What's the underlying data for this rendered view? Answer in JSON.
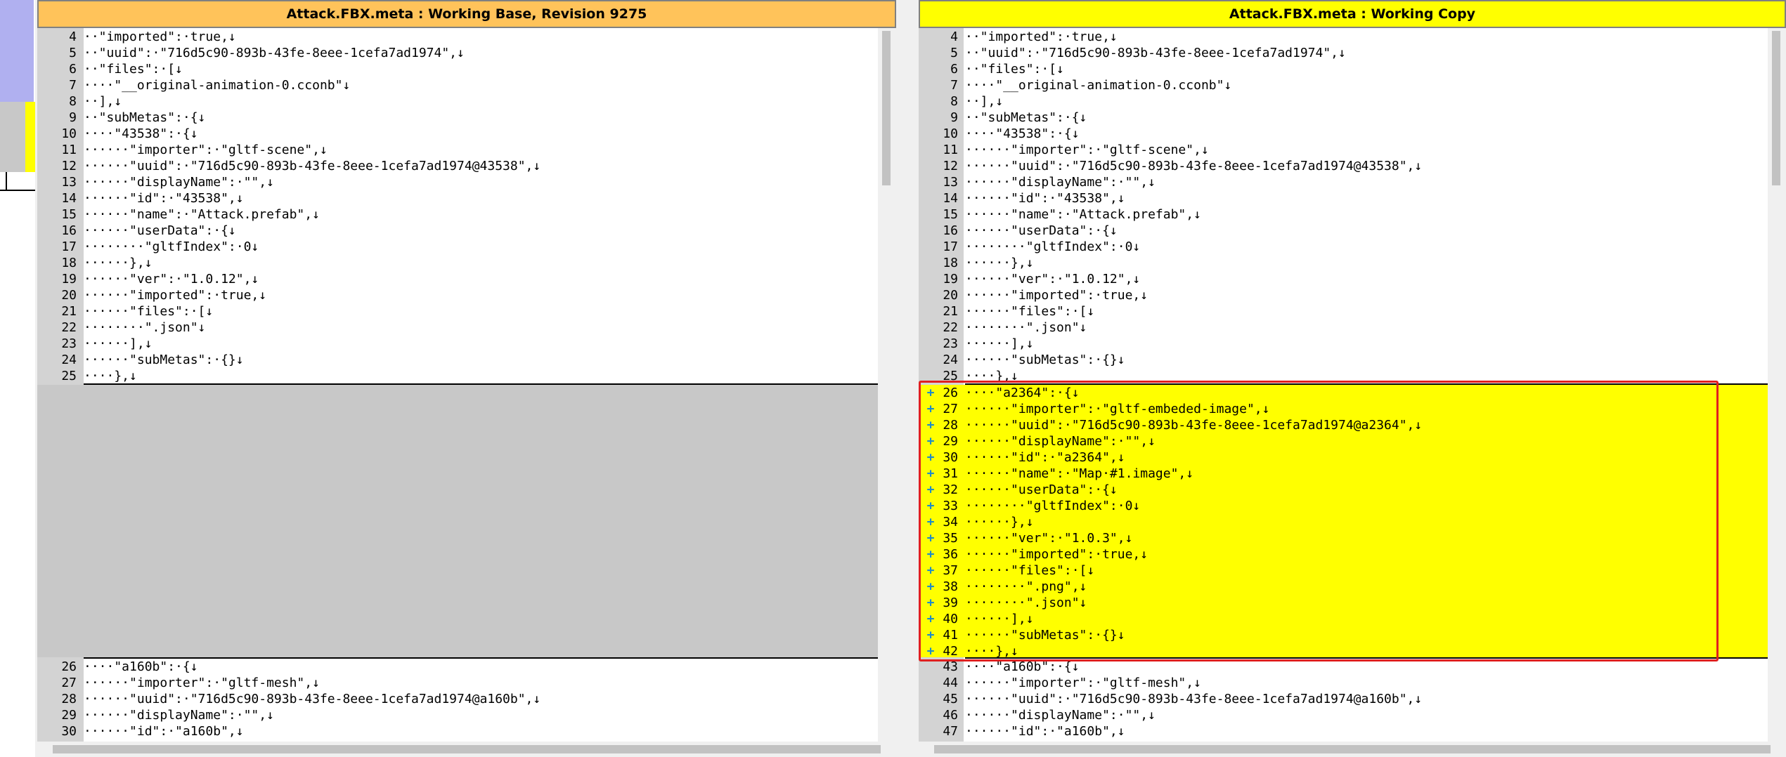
{
  "left": {
    "title": "Attack.FBX.meta : Working Base, Revision 9275",
    "top_lines": [
      {
        "n": "4",
        "t": "··\"imported\":·true,↓"
      },
      {
        "n": "5",
        "t": "··\"uuid\":·\"716d5c90-893b-43fe-8eee-1cefa7ad1974\",↓"
      },
      {
        "n": "6",
        "t": "··\"files\":·[↓"
      },
      {
        "n": "7",
        "t": "····\"__original-animation-0.cconb\"↓"
      },
      {
        "n": "8",
        "t": "··],↓"
      },
      {
        "n": "9",
        "t": "··\"subMetas\":·{↓"
      },
      {
        "n": "10",
        "t": "····\"43538\":·{↓"
      },
      {
        "n": "11",
        "t": "······\"importer\":·\"gltf-scene\",↓"
      },
      {
        "n": "12",
        "t": "······\"uuid\":·\"716d5c90-893b-43fe-8eee-1cefa7ad1974@43538\",↓"
      },
      {
        "n": "13",
        "t": "······\"displayName\":·\"\",↓"
      },
      {
        "n": "14",
        "t": "······\"id\":·\"43538\",↓"
      },
      {
        "n": "15",
        "t": "······\"name\":·\"Attack.prefab\",↓"
      },
      {
        "n": "16",
        "t": "······\"userData\":·{↓"
      },
      {
        "n": "17",
        "t": "········\"gltfIndex\":·0↓"
      },
      {
        "n": "18",
        "t": "······},↓"
      },
      {
        "n": "19",
        "t": "······\"ver\":·\"1.0.12\",↓"
      },
      {
        "n": "20",
        "t": "······\"imported\":·true,↓"
      },
      {
        "n": "21",
        "t": "······\"files\":·[↓"
      },
      {
        "n": "22",
        "t": "········\".json\"↓"
      },
      {
        "n": "23",
        "t": "······],↓"
      },
      {
        "n": "24",
        "t": "······\"subMetas\":·{}↓"
      },
      {
        "n": "25",
        "t": "····},↓"
      }
    ],
    "bottom_lines": [
      {
        "n": "26",
        "t": "····\"a160b\":·{↓"
      },
      {
        "n": "27",
        "t": "······\"importer\":·\"gltf-mesh\",↓"
      },
      {
        "n": "28",
        "t": "······\"uuid\":·\"716d5c90-893b-43fe-8eee-1cefa7ad1974@a160b\",↓"
      },
      {
        "n": "29",
        "t": "······\"displayName\":·\"\",↓"
      },
      {
        "n": "30",
        "t": "······\"id\":·\"a160b\",↓"
      }
    ]
  },
  "right": {
    "title": "Attack.FBX.meta : Working Copy",
    "top_lines": [
      {
        "n": "4",
        "t": "··\"imported\":·true,↓"
      },
      {
        "n": "5",
        "t": "··\"uuid\":·\"716d5c90-893b-43fe-8eee-1cefa7ad1974\",↓"
      },
      {
        "n": "6",
        "t": "··\"files\":·[↓"
      },
      {
        "n": "7",
        "t": "····\"__original-animation-0.cconb\"↓"
      },
      {
        "n": "8",
        "t": "··],↓"
      },
      {
        "n": "9",
        "t": "··\"subMetas\":·{↓"
      },
      {
        "n": "10",
        "t": "····\"43538\":·{↓"
      },
      {
        "n": "11",
        "t": "······\"importer\":·\"gltf-scene\",↓"
      },
      {
        "n": "12",
        "t": "······\"uuid\":·\"716d5c90-893b-43fe-8eee-1cefa7ad1974@43538\",↓"
      },
      {
        "n": "13",
        "t": "······\"displayName\":·\"\",↓"
      },
      {
        "n": "14",
        "t": "······\"id\":·\"43538\",↓"
      },
      {
        "n": "15",
        "t": "······\"name\":·\"Attack.prefab\",↓"
      },
      {
        "n": "16",
        "t": "······\"userData\":·{↓"
      },
      {
        "n": "17",
        "t": "········\"gltfIndex\":·0↓"
      },
      {
        "n": "18",
        "t": "······},↓"
      },
      {
        "n": "19",
        "t": "······\"ver\":·\"1.0.12\",↓"
      },
      {
        "n": "20",
        "t": "······\"imported\":·true,↓"
      },
      {
        "n": "21",
        "t": "······\"files\":·[↓"
      },
      {
        "n": "22",
        "t": "········\".json\"↓"
      },
      {
        "n": "23",
        "t": "······],↓"
      },
      {
        "n": "24",
        "t": "······\"subMetas\":·{}↓"
      },
      {
        "n": "25",
        "t": "····},↓"
      }
    ],
    "added_marker": "+",
    "added_lines": [
      {
        "n": "26",
        "t": "····\"a2364\":·{↓"
      },
      {
        "n": "27",
        "t": "······\"importer\":·\"gltf-embeded-image\",↓"
      },
      {
        "n": "28",
        "t": "······\"uuid\":·\"716d5c90-893b-43fe-8eee-1cefa7ad1974@a2364\",↓"
      },
      {
        "n": "29",
        "t": "······\"displayName\":·\"\",↓"
      },
      {
        "n": "30",
        "t": "······\"id\":·\"a2364\",↓"
      },
      {
        "n": "31",
        "t": "······\"name\":·\"Map·#1.image\",↓"
      },
      {
        "n": "32",
        "t": "······\"userData\":·{↓"
      },
      {
        "n": "33",
        "t": "········\"gltfIndex\":·0↓"
      },
      {
        "n": "34",
        "t": "······},↓"
      },
      {
        "n": "35",
        "t": "······\"ver\":·\"1.0.3\",↓"
      },
      {
        "n": "36",
        "t": "······\"imported\":·true,↓"
      },
      {
        "n": "37",
        "t": "······\"files\":·[↓"
      },
      {
        "n": "38",
        "t": "········\".png\",↓"
      },
      {
        "n": "39",
        "t": "········\".json\"↓"
      },
      {
        "n": "40",
        "t": "······],↓"
      },
      {
        "n": "41",
        "t": "······\"subMetas\":·{}↓"
      },
      {
        "n": "42",
        "t": "····},↓"
      }
    ],
    "bottom_lines": [
      {
        "n": "43",
        "t": "····\"a160b\":·{↓"
      },
      {
        "n": "44",
        "t": "······\"importer\":·\"gltf-mesh\",↓"
      },
      {
        "n": "45",
        "t": "······\"uuid\":·\"716d5c90-893b-43fe-8eee-1cefa7ad1974@a160b\",↓"
      },
      {
        "n": "46",
        "t": "······\"displayName\":·\"\",↓"
      },
      {
        "n": "47",
        "t": "······\"id\":·\"a160b\",↓"
      }
    ]
  },
  "colors": {
    "left_header": "#ffc35a",
    "right_header": "#ffff00",
    "added_highlight": "#ffff00",
    "gap_fill": "#c8c8c8",
    "red_box": "#e02020"
  }
}
